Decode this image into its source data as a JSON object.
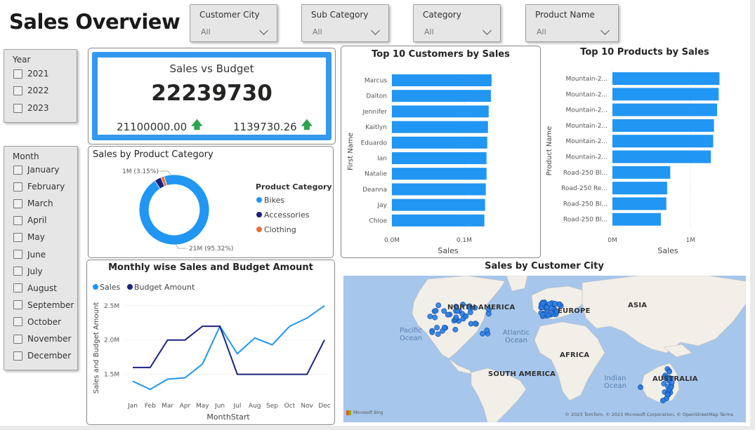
{
  "page": {
    "title": "Sales Overview"
  },
  "filters": [
    {
      "label": "Customer City",
      "value": "All"
    },
    {
      "label": "Sub Category",
      "value": "All"
    },
    {
      "label": "Category",
      "value": "All"
    },
    {
      "label": "Product Name",
      "value": "All"
    }
  ],
  "year_slicer": {
    "header": "Year",
    "items": [
      "2021",
      "2022",
      "2023"
    ]
  },
  "month_slicer": {
    "header": "Month",
    "items": [
      "January",
      "February",
      "March",
      "April",
      "May",
      "June",
      "July",
      "August",
      "September",
      "October",
      "November",
      "December"
    ]
  },
  "kpi": {
    "title": "Sales vs Budget",
    "value": "22239730",
    "left_sub": "21100000.00",
    "right_sub": "1139730.26",
    "arrow": "🡅"
  },
  "colors": {
    "accent": "#3399ee",
    "bikes": "#2196f3",
    "accessories": "#1a237e",
    "clothing": "#e8703a",
    "sales_line": "#2196f3",
    "budget_line": "#1a237e",
    "up": "#2ea44f"
  },
  "donut": {
    "title": "Sales by Product Category",
    "legend_title": "Product Category",
    "label_small": "1M (3.15%)",
    "label_big": "21M (95.32%)"
  },
  "line": {
    "title": "Monthly wise Sales and Budget Amount",
    "xlabel": "MonthStart",
    "ylabel": "Sales and Budget Amount"
  },
  "customers": {
    "title": "Top 10 Customers by Sales",
    "xlabel": "Sales",
    "ylabel": "First Name"
  },
  "products": {
    "title": "Top 10 Products by Sales",
    "xlabel": "Sales",
    "ylabel": "Product Name"
  },
  "map": {
    "title": "Sales by Customer City",
    "continents": {
      "na": "NORTH AMERICA",
      "eu": "EUROPE",
      "asia": "ASIA",
      "africa": "AFRICA",
      "sa": "SOUTH AMERICA",
      "au": "AUSTRALIA"
    },
    "oceans": {
      "pacific": "Pacific\nOcean",
      "atlantic": "Atlantic\nOcean",
      "indian": "Indian\nOcean"
    },
    "bing": "Microsoft Bing",
    "copyright": "© 2023 TomTom, © 2023 Microsoft Corporation, © OpenStreetMap  Terms"
  },
  "chart_data": [
    {
      "type": "pie",
      "title": "Sales by Product Category",
      "legend_title": "Product Category",
      "categories": [
        "Bikes",
        "Accessories",
        "Clothing"
      ],
      "values": [
        95.32,
        3.15,
        1.53
      ],
      "data_labels": [
        "21M (95.32%)",
        "1M (3.15%)",
        ""
      ]
    },
    {
      "type": "line",
      "title": "Monthly wise Sales and Budget Amount",
      "xlabel": "MonthStart",
      "ylabel": "Sales and Budget Amount",
      "categories": [
        "Jan",
        "Feb",
        "Mar",
        "Apr",
        "May",
        "Jun",
        "Jul",
        "Aug",
        "Sep",
        "Oct",
        "Nov",
        "Dec"
      ],
      "yticks": [
        "1.5M",
        "2.0M",
        "2.5M"
      ],
      "ylim": [
        1.2,
        2.6
      ],
      "series": [
        {
          "name": "Sales",
          "values": [
            1.4,
            1.28,
            1.43,
            1.45,
            1.65,
            2.2,
            1.8,
            2.03,
            1.93,
            2.2,
            2.32,
            2.5
          ]
        },
        {
          "name": "Budget Amount",
          "values": [
            1.6,
            1.6,
            2.0,
            2.0,
            2.2,
            2.2,
            1.5,
            1.5,
            1.5,
            1.5,
            1.5,
            2.0
          ]
        }
      ],
      "legend": "top-left"
    },
    {
      "type": "bar",
      "orientation": "horizontal",
      "title": "Top 10 Customers by Sales",
      "xlabel": "Sales",
      "ylabel": "First Name",
      "categories": [
        "Marcus",
        "Dalton",
        "Jennifer",
        "Kaitlyn",
        "Eduardo",
        "Ian",
        "Natalie",
        "Deanna",
        "Jay",
        "Chloe"
      ],
      "values": [
        0.138,
        0.137,
        0.134,
        0.133,
        0.132,
        0.131,
        0.131,
        0.13,
        0.129,
        0.128
      ],
      "xticks": [
        "0.0M",
        "0.1M"
      ],
      "xlim": [
        0,
        0.175
      ]
    },
    {
      "type": "bar",
      "orientation": "horizontal",
      "title": "Top 10 Products by Sales",
      "xlabel": "Sales",
      "ylabel": "Product Name",
      "categories": [
        "Mountain-2...",
        "Mountain-2...",
        "Mountain-2...",
        "Mountain-2...",
        "Mountain-2...",
        "Mountain-2...",
        "Road-250 Bl...",
        "Road-250 Re...",
        "Road-250 Bl...",
        "Road-250 Bl..."
      ],
      "values": [
        1.37,
        1.36,
        1.34,
        1.3,
        1.29,
        1.26,
        0.74,
        0.7,
        0.69,
        0.62
      ],
      "xticks": [
        "0M",
        "1M"
      ],
      "xlim": [
        0,
        1.6
      ]
    }
  ]
}
